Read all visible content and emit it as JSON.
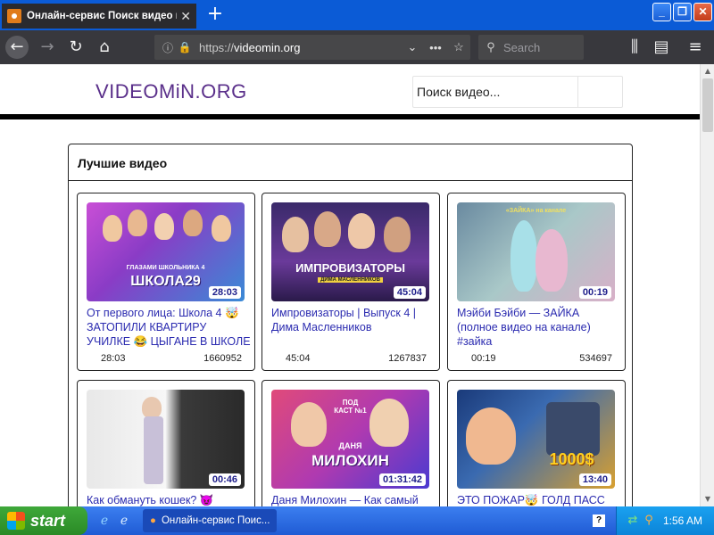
{
  "browser": {
    "tab_title": "Онлайн-сервис Поиск видео и с",
    "url_prefix": "https://",
    "url_domain": "videomin.org",
    "search_placeholder": "Search",
    "icons": {
      "back": "arrow-left-icon",
      "forward": "arrow-right-icon",
      "reload": "reload-icon",
      "home": "home-icon",
      "library": "library-icon",
      "sidebar": "sidebar-icon",
      "menu": "hamburger-menu-icon"
    }
  },
  "site": {
    "logo": "VIDEOMiN.ORG",
    "search_placeholder": "Поиск видео..."
  },
  "panel": {
    "title": "Лучшие видео"
  },
  "videos": [
    {
      "title": "От первого лица: Школа 4 🤯 ЗАТОПИЛИ КВАРТИРУ УЧИЛКЕ 😂 ЦЫГАНЕ В ШКОЛЕ 😵 ВЕРЕНИКИ...",
      "duration": "28:03",
      "views": "1660952",
      "thumb_text": "ШКОЛА29",
      "thumb_subtext": "ГЛАЗАМИ ШКОЛЬНИКА 4"
    },
    {
      "title": "Импровизаторы | Выпуск 4 | Дима Масленников",
      "duration": "45:04",
      "views": "1267837",
      "thumb_text": "ИМПРОВИЗАТОРЫ",
      "thumb_subtext": "ДИМА МАСЛЕННИКОВ"
    },
    {
      "title": "Мэйби Бэйби — ЗАЙКА (полное видео на канале) #зайка",
      "duration": "00:19",
      "views": "534697",
      "thumb_text": "«ЗАЙКА» на канале",
      "thumb_subtext": ""
    },
    {
      "title": "Как обмануть кошек? 😈",
      "duration": "00:46",
      "views": "",
      "thumb_text": "",
      "thumb_subtext": ""
    },
    {
      "title": "Даня Милохин — Как самый",
      "duration": "01:31:42",
      "views": "",
      "thumb_text": "МИЛОХИН",
      "thumb_subtext": "ДАНЯ"
    },
    {
      "title": "ЭТО ПОЖАР🤯 ГОЛД ПАСС",
      "duration": "13:40",
      "views": "",
      "thumb_text": "1000$",
      "thumb_subtext": ""
    }
  ],
  "taskbar": {
    "start_label": "start",
    "task_label": "Онлайн-сервис Поис...",
    "clock": "1:56 AM",
    "help": "?"
  }
}
